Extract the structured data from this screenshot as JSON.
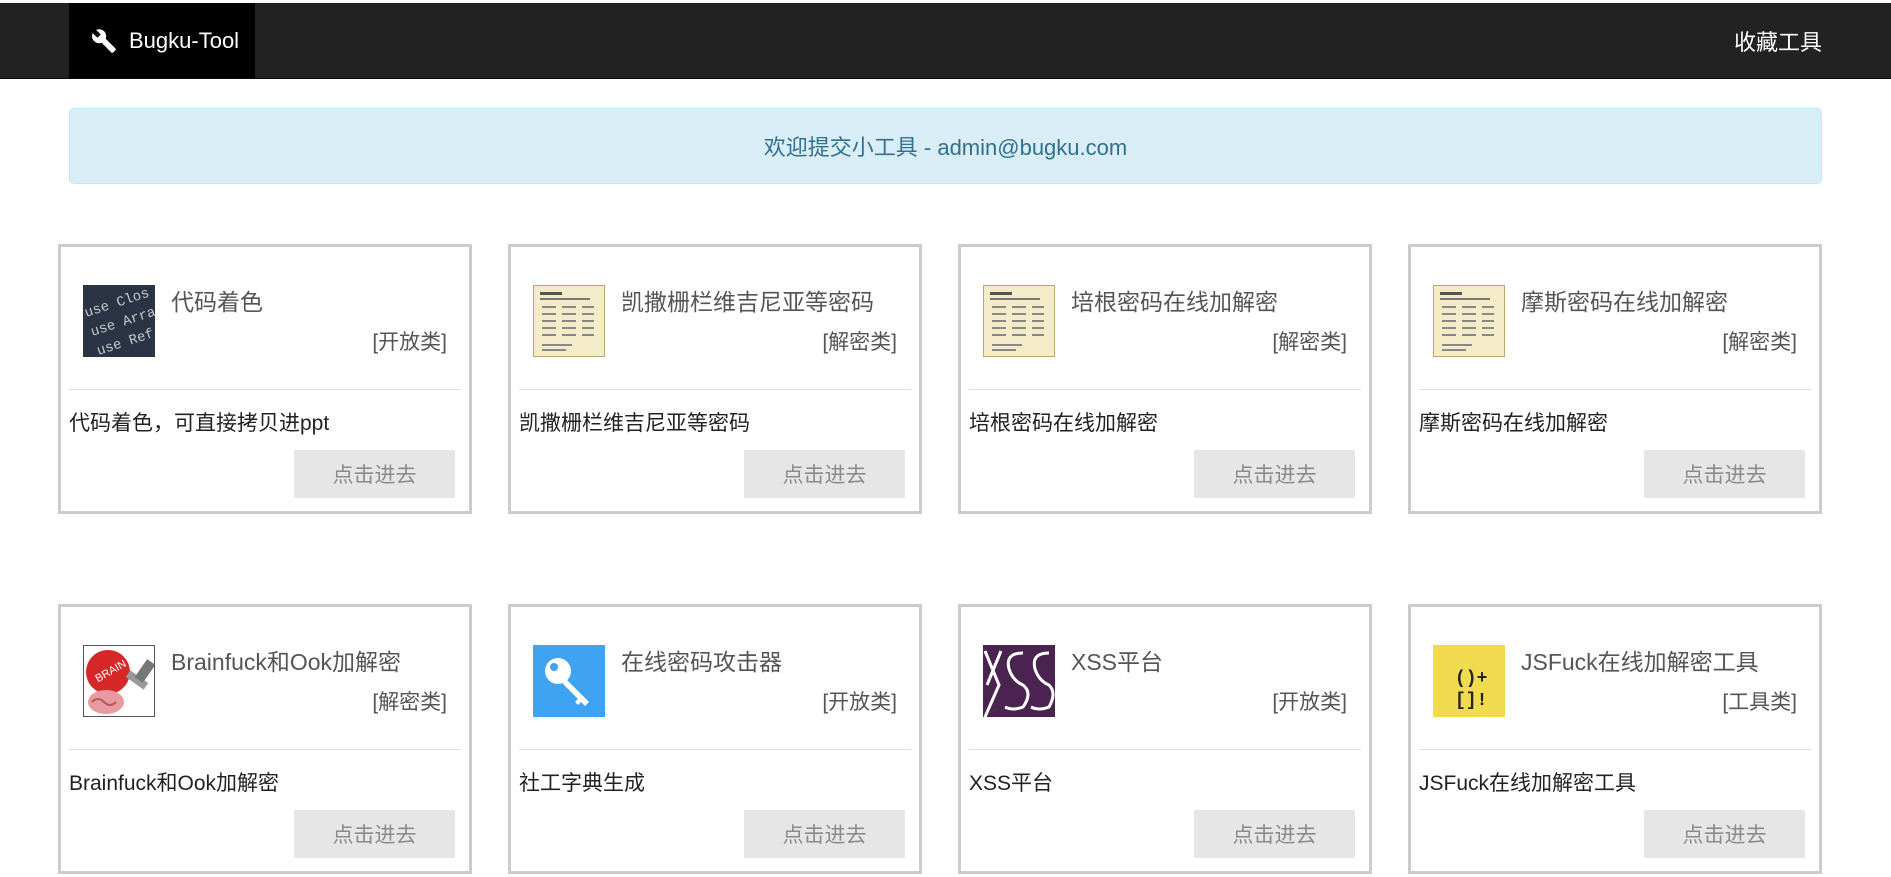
{
  "navbar": {
    "brand": "Bugku-Tool",
    "right_link": "收藏工具"
  },
  "alert": {
    "text": "欢迎提交小工具 - admin@bugku.com"
  },
  "cards": [
    {
      "title": "代码着色",
      "category": "[开放类]",
      "desc": "代码着色，可直接拷贝进ppt",
      "button": "点击进去",
      "thumb": "code-thumbnail"
    },
    {
      "title": "凯撒栅栏维吉尼亚等密码",
      "category": "[解密类]",
      "desc": "凯撒栅栏维吉尼亚等密码",
      "button": "点击进去",
      "thumb": "paper-thumbnail"
    },
    {
      "title": "培根密码在线加解密",
      "category": "[解密类]",
      "desc": "培根密码在线加解密",
      "button": "点击进去",
      "thumb": "paper-thumbnail"
    },
    {
      "title": "摩斯密码在线加解密",
      "category": "[解密类]",
      "desc": "摩斯密码在线加解密",
      "button": "点击进去",
      "thumb": "paper-thumbnail"
    },
    {
      "title": "Brainfuck和Ook加解密",
      "category": "[解密类]",
      "desc": "Brainfuck和Ook加解密",
      "button": "点击进去",
      "thumb": "brain-thumbnail"
    },
    {
      "title": "在线密码攻击器",
      "category": "[开放类]",
      "desc": "社工字典生成",
      "button": "点击进去",
      "thumb": "key-icon"
    },
    {
      "title": "XSS平台",
      "category": "[开放类]",
      "desc": "XSS平台",
      "button": "点击进去",
      "thumb": "xss-logo"
    },
    {
      "title": "JSFuck在线加解密工具",
      "category": "[工具类]",
      "desc": "JSFuck在线加解密工具",
      "button": "点击进去",
      "thumb": "jsfuck-logo"
    }
  ]
}
